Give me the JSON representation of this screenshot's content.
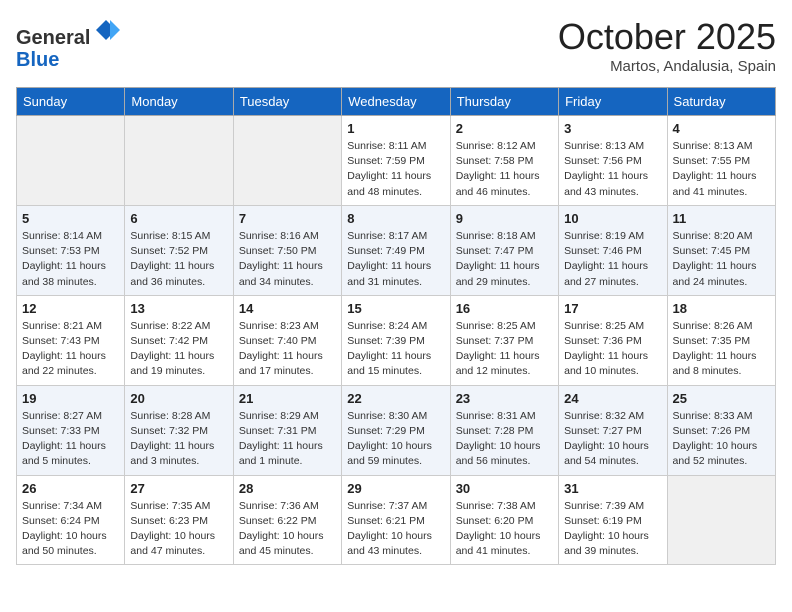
{
  "header": {
    "logo_general": "General",
    "logo_blue": "Blue",
    "month": "October 2025",
    "location": "Martos, Andalusia, Spain"
  },
  "weekdays": [
    "Sunday",
    "Monday",
    "Tuesday",
    "Wednesday",
    "Thursday",
    "Friday",
    "Saturday"
  ],
  "weeks": [
    [
      {
        "day": "",
        "info": ""
      },
      {
        "day": "",
        "info": ""
      },
      {
        "day": "",
        "info": ""
      },
      {
        "day": "1",
        "info": "Sunrise: 8:11 AM\nSunset: 7:59 PM\nDaylight: 11 hours\nand 48 minutes."
      },
      {
        "day": "2",
        "info": "Sunrise: 8:12 AM\nSunset: 7:58 PM\nDaylight: 11 hours\nand 46 minutes."
      },
      {
        "day": "3",
        "info": "Sunrise: 8:13 AM\nSunset: 7:56 PM\nDaylight: 11 hours\nand 43 minutes."
      },
      {
        "day": "4",
        "info": "Sunrise: 8:13 AM\nSunset: 7:55 PM\nDaylight: 11 hours\nand 41 minutes."
      }
    ],
    [
      {
        "day": "5",
        "info": "Sunrise: 8:14 AM\nSunset: 7:53 PM\nDaylight: 11 hours\nand 38 minutes."
      },
      {
        "day": "6",
        "info": "Sunrise: 8:15 AM\nSunset: 7:52 PM\nDaylight: 11 hours\nand 36 minutes."
      },
      {
        "day": "7",
        "info": "Sunrise: 8:16 AM\nSunset: 7:50 PM\nDaylight: 11 hours\nand 34 minutes."
      },
      {
        "day": "8",
        "info": "Sunrise: 8:17 AM\nSunset: 7:49 PM\nDaylight: 11 hours\nand 31 minutes."
      },
      {
        "day": "9",
        "info": "Sunrise: 8:18 AM\nSunset: 7:47 PM\nDaylight: 11 hours\nand 29 minutes."
      },
      {
        "day": "10",
        "info": "Sunrise: 8:19 AM\nSunset: 7:46 PM\nDaylight: 11 hours\nand 27 minutes."
      },
      {
        "day": "11",
        "info": "Sunrise: 8:20 AM\nSunset: 7:45 PM\nDaylight: 11 hours\nand 24 minutes."
      }
    ],
    [
      {
        "day": "12",
        "info": "Sunrise: 8:21 AM\nSunset: 7:43 PM\nDaylight: 11 hours\nand 22 minutes."
      },
      {
        "day": "13",
        "info": "Sunrise: 8:22 AM\nSunset: 7:42 PM\nDaylight: 11 hours\nand 19 minutes."
      },
      {
        "day": "14",
        "info": "Sunrise: 8:23 AM\nSunset: 7:40 PM\nDaylight: 11 hours\nand 17 minutes."
      },
      {
        "day": "15",
        "info": "Sunrise: 8:24 AM\nSunset: 7:39 PM\nDaylight: 11 hours\nand 15 minutes."
      },
      {
        "day": "16",
        "info": "Sunrise: 8:25 AM\nSunset: 7:37 PM\nDaylight: 11 hours\nand 12 minutes."
      },
      {
        "day": "17",
        "info": "Sunrise: 8:25 AM\nSunset: 7:36 PM\nDaylight: 11 hours\nand 10 minutes."
      },
      {
        "day": "18",
        "info": "Sunrise: 8:26 AM\nSunset: 7:35 PM\nDaylight: 11 hours\nand 8 minutes."
      }
    ],
    [
      {
        "day": "19",
        "info": "Sunrise: 8:27 AM\nSunset: 7:33 PM\nDaylight: 11 hours\nand 5 minutes."
      },
      {
        "day": "20",
        "info": "Sunrise: 8:28 AM\nSunset: 7:32 PM\nDaylight: 11 hours\nand 3 minutes."
      },
      {
        "day": "21",
        "info": "Sunrise: 8:29 AM\nSunset: 7:31 PM\nDaylight: 11 hours\nand 1 minute."
      },
      {
        "day": "22",
        "info": "Sunrise: 8:30 AM\nSunset: 7:29 PM\nDaylight: 10 hours\nand 59 minutes."
      },
      {
        "day": "23",
        "info": "Sunrise: 8:31 AM\nSunset: 7:28 PM\nDaylight: 10 hours\nand 56 minutes."
      },
      {
        "day": "24",
        "info": "Sunrise: 8:32 AM\nSunset: 7:27 PM\nDaylight: 10 hours\nand 54 minutes."
      },
      {
        "day": "25",
        "info": "Sunrise: 8:33 AM\nSunset: 7:26 PM\nDaylight: 10 hours\nand 52 minutes."
      }
    ],
    [
      {
        "day": "26",
        "info": "Sunrise: 7:34 AM\nSunset: 6:24 PM\nDaylight: 10 hours\nand 50 minutes."
      },
      {
        "day": "27",
        "info": "Sunrise: 7:35 AM\nSunset: 6:23 PM\nDaylight: 10 hours\nand 47 minutes."
      },
      {
        "day": "28",
        "info": "Sunrise: 7:36 AM\nSunset: 6:22 PM\nDaylight: 10 hours\nand 45 minutes."
      },
      {
        "day": "29",
        "info": "Sunrise: 7:37 AM\nSunset: 6:21 PM\nDaylight: 10 hours\nand 43 minutes."
      },
      {
        "day": "30",
        "info": "Sunrise: 7:38 AM\nSunset: 6:20 PM\nDaylight: 10 hours\nand 41 minutes."
      },
      {
        "day": "31",
        "info": "Sunrise: 7:39 AM\nSunset: 6:19 PM\nDaylight: 10 hours\nand 39 minutes."
      },
      {
        "day": "",
        "info": ""
      }
    ]
  ]
}
